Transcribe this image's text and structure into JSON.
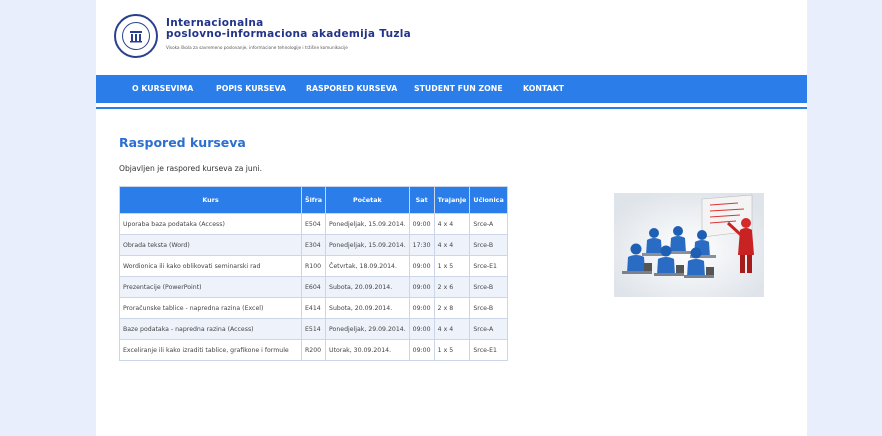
{
  "header": {
    "brand_line1": "Internacionalna",
    "brand_line2": "poslovno-informaciona akademija Tuzla",
    "brand_sub": "Visoka škola za savremeno poslovanje, informacione tehnologije i tržišne komunikacije"
  },
  "nav": {
    "items": [
      {
        "label": "O KURSEVIMA"
      },
      {
        "label": "POPIS KURSEVA"
      },
      {
        "label": "RASPORED KURSEVA"
      },
      {
        "label": "STUDENT FUN ZONE"
      },
      {
        "label": "KONTAKT"
      }
    ]
  },
  "main": {
    "title": "Raspored kurseva",
    "intro": "Objavljen je raspored kurseva za juni."
  },
  "table": {
    "headers": [
      "Kurs",
      "Šifra",
      "Početak",
      "Sat",
      "Trajanje",
      "Učionica"
    ],
    "rows": [
      [
        "Uporaba baza podataka (Access)",
        "E504",
        "Ponedjeljak, 15.09.2014.",
        "09:00",
        "4 x 4",
        "Srce-A"
      ],
      [
        "Obrada teksta (Word)",
        "E304",
        "Ponedjeljak, 15.09.2014.",
        "17:30",
        "4 x 4",
        "Srce-B"
      ],
      [
        "Wordionica ili kako oblikovati seminarski rad",
        "R100",
        "Četvrtak, 18.09.2014.",
        "09:00",
        "1 x 5",
        "Srce-E1"
      ],
      [
        "Prezentacije (PowerPoint)",
        "E604",
        "Subota, 20.09.2014.",
        "09:00",
        "2 x 6",
        "Srce-B"
      ],
      [
        "Proračunske tablice - napredna razina (Excel)",
        "E414",
        "Subota, 20.09.2014.",
        "09:00",
        "2 x 8",
        "Srce-B"
      ],
      [
        "Baze podataka - napredna razina (Access)",
        "E514",
        "Ponedjeljak, 29.09.2014.",
        "09:00",
        "4 x 4",
        "Srce-A"
      ],
      [
        "Exceliranje ili kako izraditi tablice, grafikone i formule",
        "R200",
        "Utorak, 30.09.2014.",
        "09:00",
        "1 x 5",
        "Srce-E1"
      ]
    ]
  },
  "colors": {
    "accent": "#2b7de9",
    "title": "#2b6fd1",
    "background": "#e8eefb"
  },
  "icons": {
    "logo": "academy-seal-icon",
    "illustration": "presentation-classroom-illustration"
  }
}
